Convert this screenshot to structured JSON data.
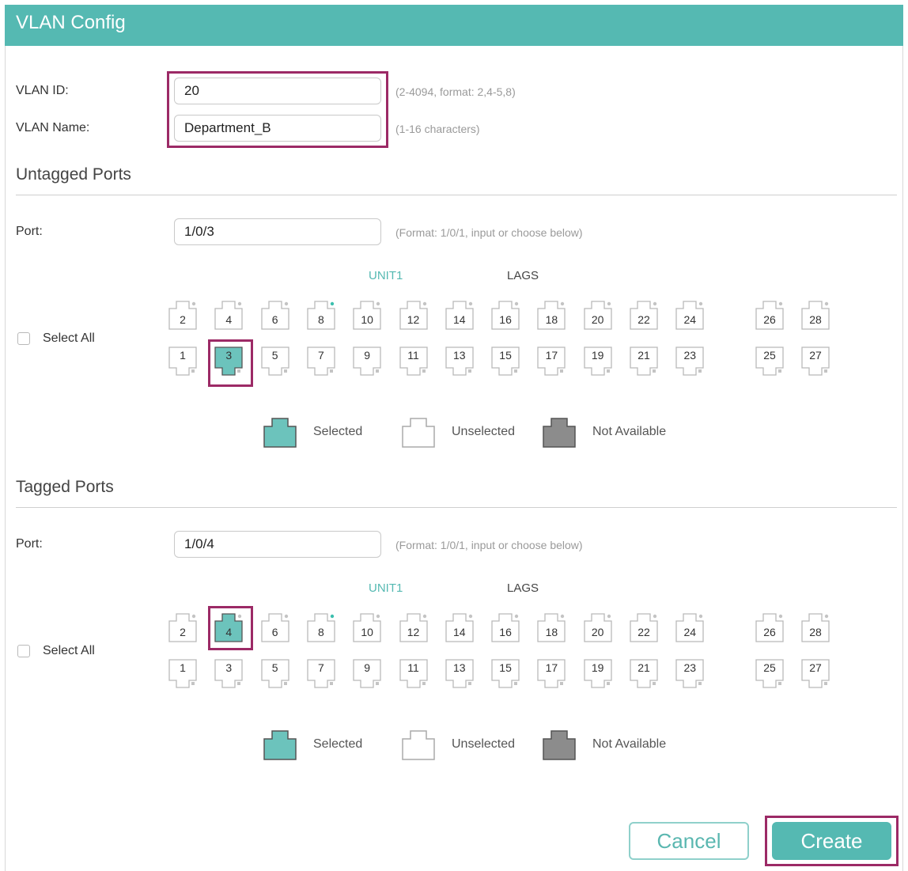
{
  "window": {
    "title": "VLAN Config"
  },
  "vlan": {
    "id_label": "VLAN ID:",
    "id_value": "20",
    "id_hint": "(2-4094, format: 2,4-5,8)",
    "name_label": "VLAN Name:",
    "name_value": "Department_B",
    "name_hint": "(1-16 characters)"
  },
  "untagged": {
    "title": "Untagged Ports",
    "port_label": "Port:",
    "port_value": "1/0/3",
    "port_hint": "(Format: 1/0/1, input or choose below)",
    "unit_label": "UNIT1",
    "lags_label": "LAGS",
    "select_all": "Select All",
    "top_ports": [
      "2",
      "4",
      "6",
      "8",
      "10",
      "12",
      "14",
      "16",
      "18",
      "20",
      "22",
      "24"
    ],
    "bottom_ports": [
      "1",
      "3",
      "5",
      "7",
      "9",
      "11",
      "13",
      "15",
      "17",
      "19",
      "21",
      "23"
    ],
    "lag_top": [
      "26",
      "28"
    ],
    "lag_bottom": [
      "25",
      "27"
    ],
    "selected_ports": [
      "3"
    ],
    "legend": {
      "selected": "Selected",
      "unselected": "Unselected",
      "not_available": "Not Available"
    }
  },
  "tagged": {
    "title": "Tagged Ports",
    "port_label": "Port:",
    "port_value": "1/0/4",
    "port_hint": "(Format: 1/0/1, input or choose below)",
    "unit_label": "UNIT1",
    "lags_label": "LAGS",
    "select_all": "Select All",
    "top_ports": [
      "2",
      "4",
      "6",
      "8",
      "10",
      "12",
      "14",
      "16",
      "18",
      "20",
      "22",
      "24"
    ],
    "bottom_ports": [
      "1",
      "3",
      "5",
      "7",
      "9",
      "11",
      "13",
      "15",
      "17",
      "19",
      "21",
      "23"
    ],
    "lag_top": [
      "26",
      "28"
    ],
    "lag_bottom": [
      "25",
      "27"
    ],
    "selected_ports": [
      "4"
    ],
    "legend": {
      "selected": "Selected",
      "unselected": "Unselected",
      "not_available": "Not Available"
    }
  },
  "buttons": {
    "cancel": "Cancel",
    "create": "Create"
  },
  "colors": {
    "accent": "#55b9b2",
    "highlight": "#9c2a66",
    "selected": "#6cc3bc",
    "not_available": "#8c8c8c"
  }
}
